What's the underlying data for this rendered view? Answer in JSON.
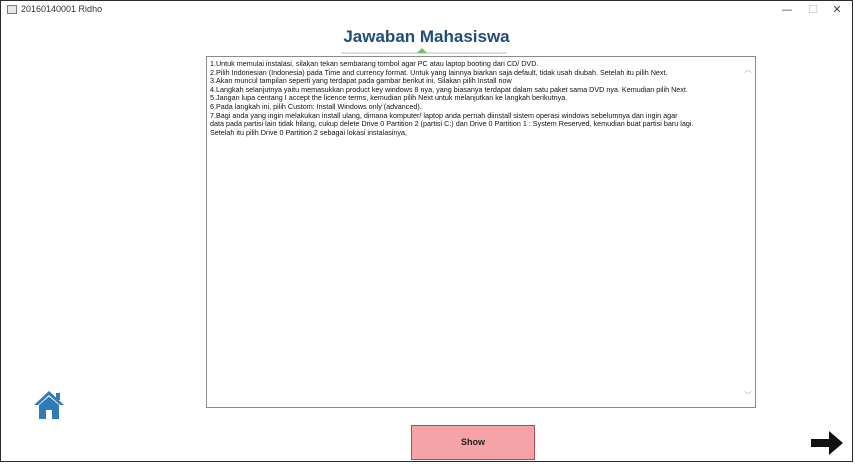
{
  "window": {
    "title": "20160140001 Ridho",
    "minimize_glyph": "—",
    "maximize_glyph": "☐",
    "close_glyph": "✕"
  },
  "page": {
    "title": "Jawaban Mahasiswa"
  },
  "answer": {
    "lines": [
      "1.Untuk memulai instalasi, silakan tekan sembarang tombol agar PC atau laptop booting dari CD/ DVD.",
      "2.Pilih Indonesian (Indonesia) pada Time and currency format. Untuk yang lainnya biarkan saja default, tidak usah diubah. Setelah itu pilih Next.",
      "3.Akan muncul tampilan seperti yang terdapat pada gambar berikut ini. Silakan pilih Install now",
      "4.Langkah selanjutnya yaitu memasukkan product key windows 8 nya, yang biasanya terdapat dalam satu paket sama DVD nya. Kemudian pilih Next.",
      "5.Jangan lupa centang I accept the licence terms, kemudian pilih Next untuk melanjutkan ke langkah berikutnya.",
      "6.Pada langkah ini, pilih Custom: Install Windows only (advanced).",
      "7.Bagi anda yang ingin melakukan install ulang, dimana komputer/ laptop anda pernah diinstall sistem operasi windows sebelumnya dan ingin agar",
      "data pada partisi lain tidak hilang, cukup delete Drive 0 Partition 2 (partisi C:) dan Drive 0 Partition 1 : System Reserved, kemudian buat partisi baru lagi.",
      "Setelah itu pilih Drive 0 Partition 2 sebagai lokasi instalasinya,"
    ]
  },
  "buttons": {
    "show_label": "Show"
  },
  "icons": {
    "home": "home-icon",
    "next": "arrow-right-icon",
    "scroll_up": "chevron-up-icon",
    "scroll_down": "chevron-down-icon",
    "home_color": "#2e7bb5"
  }
}
